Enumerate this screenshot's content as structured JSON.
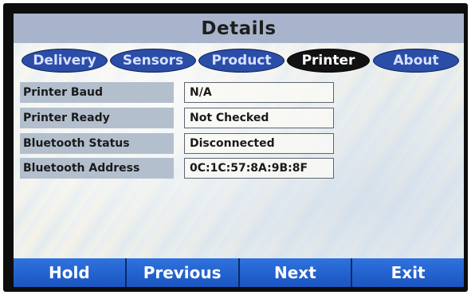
{
  "header": {
    "title": "Details"
  },
  "tabs": [
    {
      "label": "Delivery",
      "active": false
    },
    {
      "label": "Sensors",
      "active": false
    },
    {
      "label": "Product",
      "active": false
    },
    {
      "label": "Printer",
      "active": true
    },
    {
      "label": "About",
      "active": false
    }
  ],
  "details": [
    {
      "label": "Printer Baud",
      "value": "N/A"
    },
    {
      "label": "Printer Ready",
      "value": "Not Checked"
    },
    {
      "label": "Bluetooth Status",
      "value": "Disconnected"
    },
    {
      "label": "Bluetooth Address",
      "value": "0C:1C:57:8A:9B:8F"
    }
  ],
  "footer": {
    "hold": "Hold",
    "previous": "Previous",
    "next": "Next",
    "exit": "Exit"
  },
  "colors": {
    "tab_blue": "#2a4ea8",
    "tab_active": "#121212",
    "header_bg": "#a8b4cc",
    "label_bg": "#b3bfcd",
    "footer_blue": "#2f72df"
  }
}
